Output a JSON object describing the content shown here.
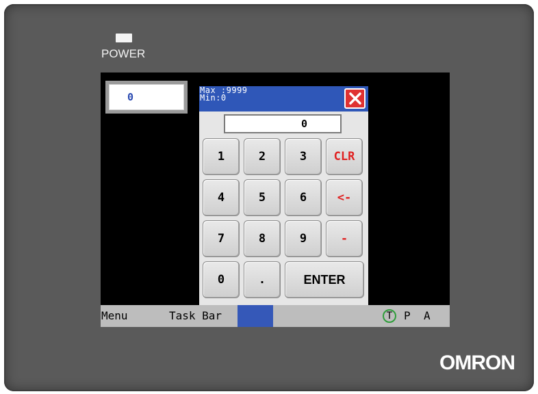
{
  "device": {
    "power_label": "POWER",
    "brand": "OMRON"
  },
  "screen": {
    "num_display_value": "0",
    "keypad": {
      "max_label": "Max :9999",
      "min_label": "Min:0",
      "entry_value": "0",
      "close_icon": "close-x-icon",
      "keys": {
        "k1": "1",
        "k2": "2",
        "k3": "3",
        "clr": "CLR",
        "k4": "4",
        "k5": "5",
        "k6": "6",
        "back": "<-",
        "k7": "7",
        "k8": "8",
        "k9": "9",
        "minus": "-",
        "k0": "0",
        "dot": ".",
        "enter": "ENTER"
      },
      "colors": {
        "header": "#2f57b8",
        "close": "#e03131",
        "accent_keys": "#e02020"
      }
    },
    "taskbar": {
      "menu_label": "Menu",
      "taskbar_label": "Task Bar",
      "t_label": "T",
      "p_label": "P",
      "a_label": "A"
    }
  }
}
